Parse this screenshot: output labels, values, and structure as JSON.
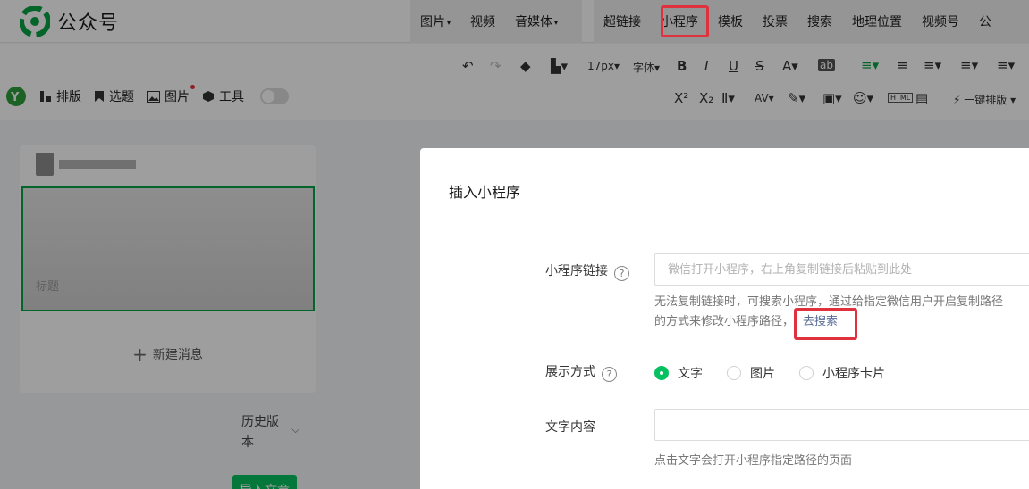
{
  "app": {
    "name": "公众号"
  },
  "menu": {
    "group1": [
      {
        "label": "图片",
        "caret": true
      },
      {
        "label": "视频",
        "caret": false
      },
      {
        "label": "音媒体",
        "caret": true
      }
    ],
    "group2": [
      {
        "label": "超链接"
      },
      {
        "label": "小程序"
      },
      {
        "label": "模板"
      },
      {
        "label": "投票"
      },
      {
        "label": "搜索"
      },
      {
        "label": "地理位置"
      },
      {
        "label": "视频号"
      },
      {
        "label": "公"
      }
    ]
  },
  "toolbar": {
    "font_size": "17px",
    "font_family": "字体",
    "one_click": "一键排版"
  },
  "left_tools": {
    "layout": "排版",
    "topic": "选题",
    "image": "图片",
    "tools": "工具"
  },
  "article": {
    "cover_title": "标题",
    "new_message": "新建消息",
    "history_line1": "历史版",
    "history_line2": "本",
    "import_button": "导入文章"
  },
  "dialog": {
    "title": "插入小程序",
    "link_label": "小程序链接",
    "link_placeholder": "微信打开小程序，右上角复制链接后粘贴到此处",
    "tip_line1": "无法复制链接时，可搜索小程序，通过给指定微信用户开启复制路径",
    "tip_line2": "的方式来修改小程序路径，",
    "search_link": "去搜索",
    "display_label": "展示方式",
    "display_options": [
      "文字",
      "图片",
      "小程序卡片"
    ],
    "display_selected": "文字",
    "text_label": "文字内容",
    "text_value": "",
    "text_hint": "点击文字会打开小程序指定路径的页面"
  },
  "colors": {
    "accent": "#07c160",
    "highlight": "#e0323e",
    "link": "#576b95"
  }
}
